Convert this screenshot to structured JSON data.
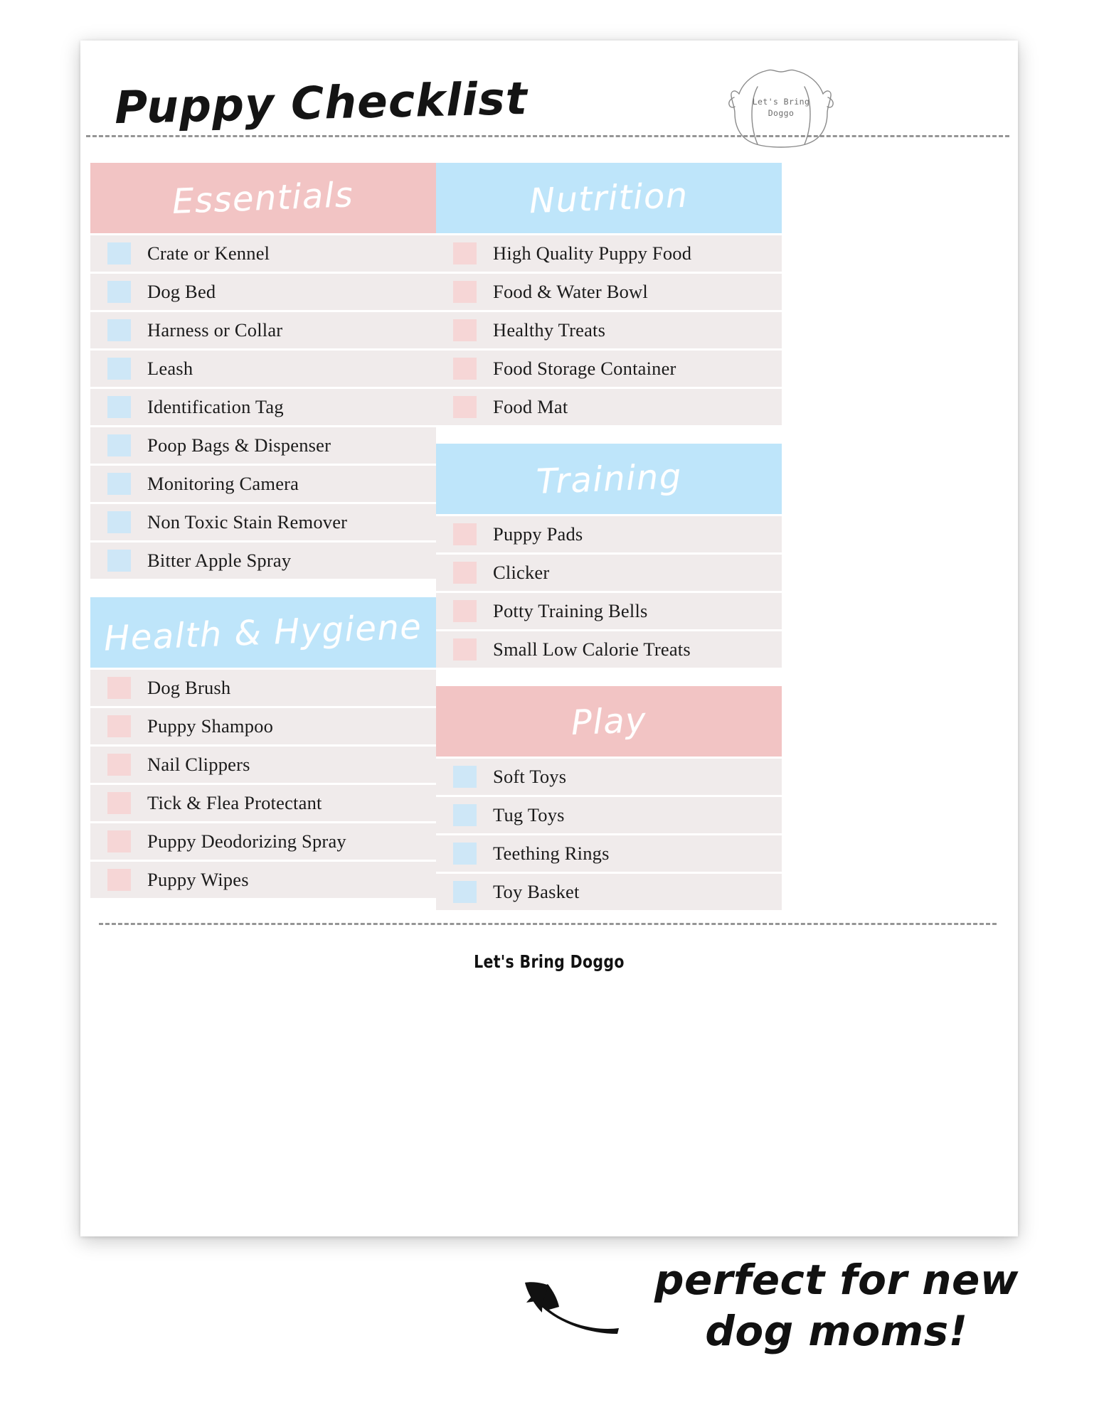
{
  "page": {
    "title": "Puppy Checklist",
    "footer": "Let's Bring Doggo"
  },
  "logo": {
    "name": "dog-head-outline",
    "line1": "Let's Bring",
    "line2": "Doggo"
  },
  "annotation": {
    "line1": "perfect for new",
    "line2": "dog moms!",
    "arrow": "curved-arrow-up-left"
  },
  "colors": {
    "pink_header": "#f2c4c4",
    "blue_header": "#bee5fa",
    "row_bg": "#f0ebeb",
    "checkbox_blue": "#cee7f7",
    "checkbox_pink": "#f6d6d6"
  },
  "columns": {
    "left": [
      {
        "title": "Essentials",
        "header_color": "pink",
        "checkbox_color": "blue",
        "items": [
          "Crate or Kennel",
          "Dog Bed",
          "Harness or Collar",
          "Leash",
          "Identification Tag",
          "Poop Bags & Dispenser",
          "Monitoring Camera",
          " Non Toxic Stain Remover",
          "Bitter Apple Spray"
        ]
      },
      {
        "title": "Health & Hygiene",
        "header_color": "blue",
        "checkbox_color": "pink",
        "items": [
          "Dog Brush",
          "Puppy Shampoo",
          "Nail Clippers",
          "Tick & Flea Protectant",
          "Puppy Deodorizing Spray",
          "Puppy Wipes"
        ]
      }
    ],
    "right": [
      {
        "title": "Nutrition",
        "header_color": "blue",
        "checkbox_color": "pink",
        "items": [
          "High Quality Puppy Food",
          "Food & Water Bowl",
          "Healthy Treats",
          "Food Storage Container",
          "Food Mat"
        ]
      },
      {
        "title": "Training",
        "header_color": "blue",
        "checkbox_color": "pink",
        "items": [
          "Puppy Pads",
          "Clicker",
          "Potty Training Bells",
          "Small Low Calorie Treats"
        ]
      },
      {
        "title": "Play",
        "header_color": "pink",
        "checkbox_color": "blue",
        "items": [
          "Soft Toys",
          "Tug Toys",
          "Teething Rings",
          "Toy Basket"
        ]
      }
    ]
  }
}
